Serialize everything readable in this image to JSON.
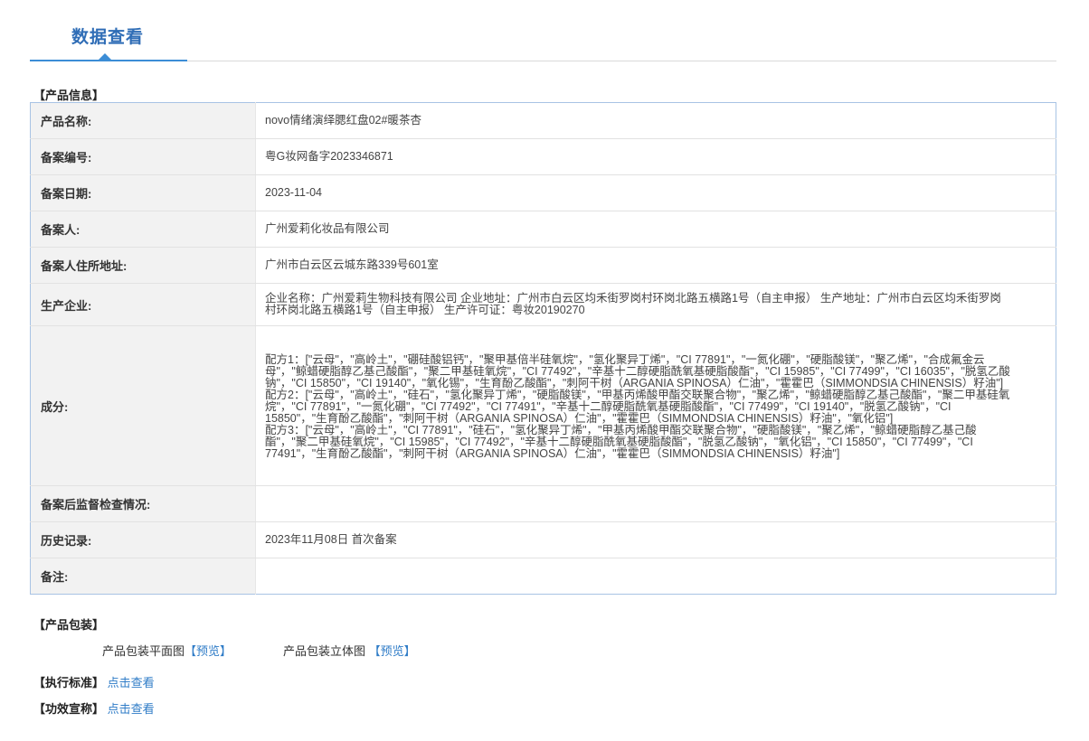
{
  "tab": {
    "title": "数据查看"
  },
  "product_info": {
    "section_title": "【产品信息】",
    "rows": [
      {
        "label": "产品名称:",
        "value": "novo情绪演绎腮红盘02#暖茶杏"
      },
      {
        "label": "备案编号:",
        "value": "粤G妆网备字2023346871"
      },
      {
        "label": "备案日期:",
        "value": "2023-11-04"
      },
      {
        "label": "备案人:",
        "value": "广州爱莉化妆品有限公司"
      },
      {
        "label": "备案人住所地址:",
        "value": "广州市白云区云城东路339号601室"
      },
      {
        "label": "生产企业:",
        "value": "企业名称：广州爱莉生物科技有限公司 企业地址：广州市白云区均禾街罗岗村环岗北路五横路1号（自主申报） 生产地址：广州市白云区均禾街罗岗村环岗北路五横路1号（自主申报） 生产许可证：粤妆20190270"
      },
      {
        "label": "成分:",
        "value": "配方1：[\"云母\"，\"高岭土\"，\"硼硅酸铝钙\"，\"聚甲基倍半硅氧烷\"，\"氢化聚异丁烯\"，\"CI 77891\"，\"一氮化硼\"，\"硬脂酸镁\"，\"聚乙烯\"，\"合成氟金云母\"，\"鲸蜡硬脂醇乙基己酸酯\"，\"聚二甲基硅氧烷\"，\"CI 77492\"，\"辛基十二醇硬脂酰氧基硬脂酸酯\"，\"CI 15985\"，\"CI 77499\"，\"CI 16035\"，\"脱氢乙酸钠\"，\"CI 15850\"，\"CI 19140\"，\"氧化锡\"，\"生育酚乙酸酯\"，\"刺阿干树（ARGANIA SPINOSA）仁油\"，\"霍霍巴（SIMMONDSIA CHINENSIS）籽油\"]\n配方2：[\"云母\"，\"高岭土\"，\"硅石\"，\"氢化聚异丁烯\"，\"硬脂酸镁\"，\"甲基丙烯酸甲酯交联聚合物\"，\"聚乙烯\"，\"鲸蜡硬脂醇乙基己酸酯\"，\"聚二甲基硅氧烷\"，\"CI 77891\"，\"一氮化硼\"，\"CI 77492\"，\"CI 77491\"，\"辛基十二醇硬脂酰氧基硬脂酸酯\"，\"CI 77499\"，\"CI 19140\"，\"脱氢乙酸钠\"，\"CI 15850\"，\"生育酚乙酸酯\"，\"刺阿干树（ARGANIA SPINOSA）仁油\"，\"霍霍巴（SIMMONDSIA CHINENSIS）籽油\"，\"氧化铝\"]\n配方3：[\"云母\"，\"高岭土\"，\"CI 77891\"，\"硅石\"，\"氢化聚异丁烯\"，\"甲基丙烯酸甲酯交联聚合物\"，\"硬脂酸镁\"，\"聚乙烯\"，\"鲸蜡硬脂醇乙基己酸酯\"，\"聚二甲基硅氧烷\"，\"CI 15985\"，\"CI 77492\"，\"辛基十二醇硬脂酰氧基硬脂酸酯\"，\"脱氢乙酸钠\"，\"氧化铝\"，\"CI 15850\"，\"CI 77499\"，\"CI 77491\"，\"生育酚乙酸酯\"，\"刺阿干树（ARGANIA SPINOSA）仁油\"，\"霍霍巴（SIMMONDSIA CHINENSIS）籽油\"]"
      },
      {
        "label": "备案后监督检查情况:",
        "value": ""
      },
      {
        "label": "历史记录:",
        "value": "2023年11月08日 首次备案"
      },
      {
        "label": "备注:",
        "value": ""
      }
    ]
  },
  "packaging": {
    "section_title": "【产品包装】",
    "flat_label": "产品包装平面图",
    "flat_link": "【预览】",
    "solid_label": "产品包装立体图",
    "solid_link": "【预览】"
  },
  "standard": {
    "label": "【执行标准】",
    "link": "点击查看"
  },
  "efficacy": {
    "label": "【功效宣称】",
    "link": "点击查看"
  }
}
